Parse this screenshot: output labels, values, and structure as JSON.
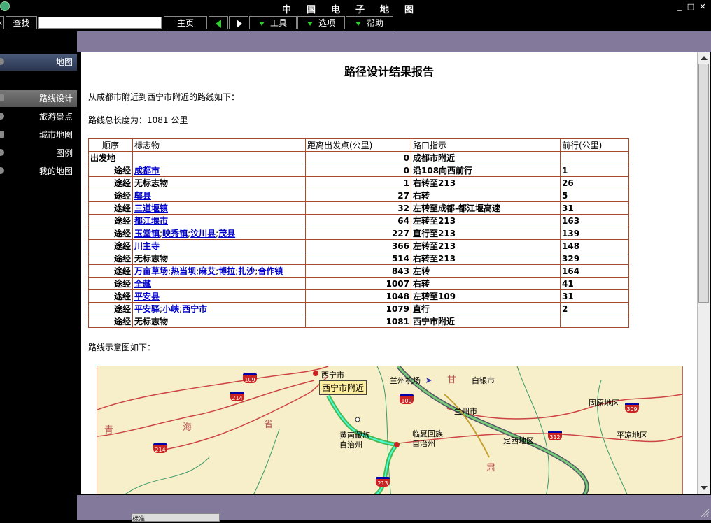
{
  "window": {
    "title": "中国电子地图"
  },
  "toolbar": {
    "search_label": "查找",
    "search_value": "",
    "home_label": "主页",
    "tools_label": "工具",
    "options_label": "选项",
    "help_label": "帮助"
  },
  "sidebar": {
    "items": [
      {
        "label": "地图"
      },
      {
        "label": "路线设计"
      },
      {
        "label": "旅游景点"
      },
      {
        "label": "城市地图"
      },
      {
        "label": "图例"
      },
      {
        "label": "我的地图"
      }
    ]
  },
  "report": {
    "title": "路径设计结果报告",
    "intro": "从成都市附近到西宁市附近的路线如下：",
    "total_length": "路线总长度为：1081 公里",
    "columns": [
      "顺序",
      "标志物",
      "距离出发点(公里)",
      "路口指示",
      "前行(公里)"
    ],
    "rows": [
      {
        "type": "出发地",
        "landmarks": [],
        "dist": "0",
        "direction": "成都市附近",
        "forward": ""
      },
      {
        "type": "途经",
        "landmarks": [
          "成都市"
        ],
        "dist": "0",
        "direction": "沿108向西前行",
        "forward": "1"
      },
      {
        "type": "途经",
        "landmarks": [],
        "landmark_text": "无标志物",
        "dist": "1",
        "direction": "右转至213",
        "forward": "26"
      },
      {
        "type": "途经",
        "landmarks": [
          "郫县"
        ],
        "dist": "27",
        "direction": "右转",
        "forward": "5"
      },
      {
        "type": "途经",
        "landmarks": [
          "三道堰镇"
        ],
        "dist": "32",
        "direction": "左转至成都-都江堰高速",
        "forward": "31"
      },
      {
        "type": "途经",
        "landmarks": [
          "都江堰市"
        ],
        "dist": "64",
        "direction": "左转至213",
        "forward": "163"
      },
      {
        "type": "途经",
        "landmarks": [
          "玉堂镇",
          "映秀镇",
          "汶川县",
          "茂县"
        ],
        "dist": "227",
        "direction": "直行至213",
        "forward": "139"
      },
      {
        "type": "途经",
        "landmarks": [
          "川主寺"
        ],
        "dist": "366",
        "direction": "左转至213",
        "forward": "148"
      },
      {
        "type": "途经",
        "landmarks": [],
        "landmark_text": "无标志物",
        "dist": "514",
        "direction": "右转至213",
        "forward": "329"
      },
      {
        "type": "途经",
        "landmarks": [
          "万亩草场",
          "热当坝",
          "麻艾",
          "博拉",
          "扎沙",
          "合作镇"
        ],
        "dist": "843",
        "direction": "左转",
        "forward": "164"
      },
      {
        "type": "途经",
        "landmarks": [
          "全藏"
        ],
        "dist": "1007",
        "direction": "右转",
        "forward": "41"
      },
      {
        "type": "途经",
        "landmarks": [
          "平安县"
        ],
        "dist": "1048",
        "direction": "左转至109",
        "forward": "31"
      },
      {
        "type": "途经",
        "landmarks": [
          "平安驿",
          "小峡",
          "西宁市"
        ],
        "dist": "1079",
        "direction": "直行",
        "forward": "2"
      },
      {
        "type": "途经",
        "landmarks": [],
        "landmark_text": "无标志物",
        "dist": "1081",
        "direction": "西宁市附近",
        "forward": ""
      }
    ],
    "map_caption": "路线示意图如下："
  },
  "map": {
    "callout": "西宁市附近",
    "labels": [
      "西宁市",
      "兰州机场",
      "白银市",
      "兰州市",
      "固原地区",
      "临夏回族",
      "自治州",
      "黄南藏族",
      "自治州",
      "定西地区",
      "平凉地区"
    ],
    "provinces": [
      "青",
      "海",
      "省",
      "甘",
      "肃"
    ],
    "shields": [
      "109",
      "214",
      "214",
      "109",
      "312",
      "309",
      "213"
    ]
  },
  "status": {
    "tab_label": "标准"
  }
}
